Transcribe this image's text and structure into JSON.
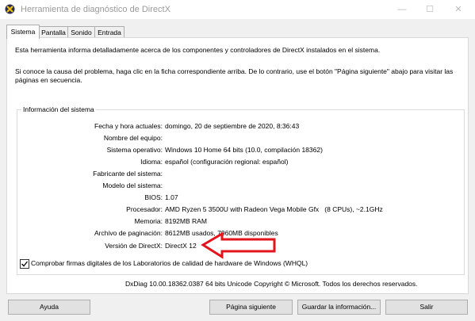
{
  "window": {
    "title": "Herramienta de diagnóstico de DirectX",
    "minimize": "—",
    "maximize": "☐",
    "close": "✕"
  },
  "tabs": [
    {
      "label": "Sistema",
      "active": true
    },
    {
      "label": "Pantalla",
      "active": false
    },
    {
      "label": "Sonido",
      "active": false
    },
    {
      "label": "Entrada",
      "active": false
    }
  ],
  "intro": {
    "line1": "Esta herramienta informa detalladamente acerca de los componentes y controladores de DirectX instalados en el sistema.",
    "line2": "Si conoce la causa del problema, haga clic en la ficha correspondiente arriba. De lo contrario, use el botón \"Página siguiente\" abajo para visitar las páginas en secuencia."
  },
  "system_info": {
    "group_title": "Información del sistema",
    "rows": [
      {
        "label": "Fecha y hora actuales:",
        "value": "domingo, 20 de septiembre de 2020, 8:36:43"
      },
      {
        "label": "Nombre del equipo:",
        "value": ""
      },
      {
        "label": "Sistema operativo:",
        "value": "Windows 10 Home 64 bits (10.0, compilación 18362)"
      },
      {
        "label": "Idioma:",
        "value": "español (configuración regional: español)"
      },
      {
        "label": "Fabricante del sistema:",
        "value": ""
      },
      {
        "label": "Modelo del sistema:",
        "value": ""
      },
      {
        "label": "BIOS:",
        "value": "1.07"
      },
      {
        "label": "Procesador:",
        "value": "AMD Ryzen 5 3500U with Radeon Vega Mobile Gfx   (8 CPUs), ~2.1GHz"
      },
      {
        "label": "Memoria:",
        "value": "8192MB RAM"
      },
      {
        "label": "Archivo de paginación:",
        "value": "8612MB usados, 7960MB disponibles"
      },
      {
        "label": "Versión de DirectX:",
        "value": "DirectX 12"
      }
    ]
  },
  "whql": {
    "label": "Comprobar firmas digitales de los Laboratorios de calidad de hardware de Windows (WHQL)",
    "checked": true
  },
  "footer": "DxDiag 10.00.18362.0387 64 bits Unicode  Copyright © Microsoft. Todos los derechos reservados.",
  "buttons": {
    "help": "Ayuda",
    "next_page": "Página siguiente",
    "save_info": "Guardar la información...",
    "exit": "Salir"
  },
  "colors": {
    "annotation_arrow": "#e3141b"
  }
}
